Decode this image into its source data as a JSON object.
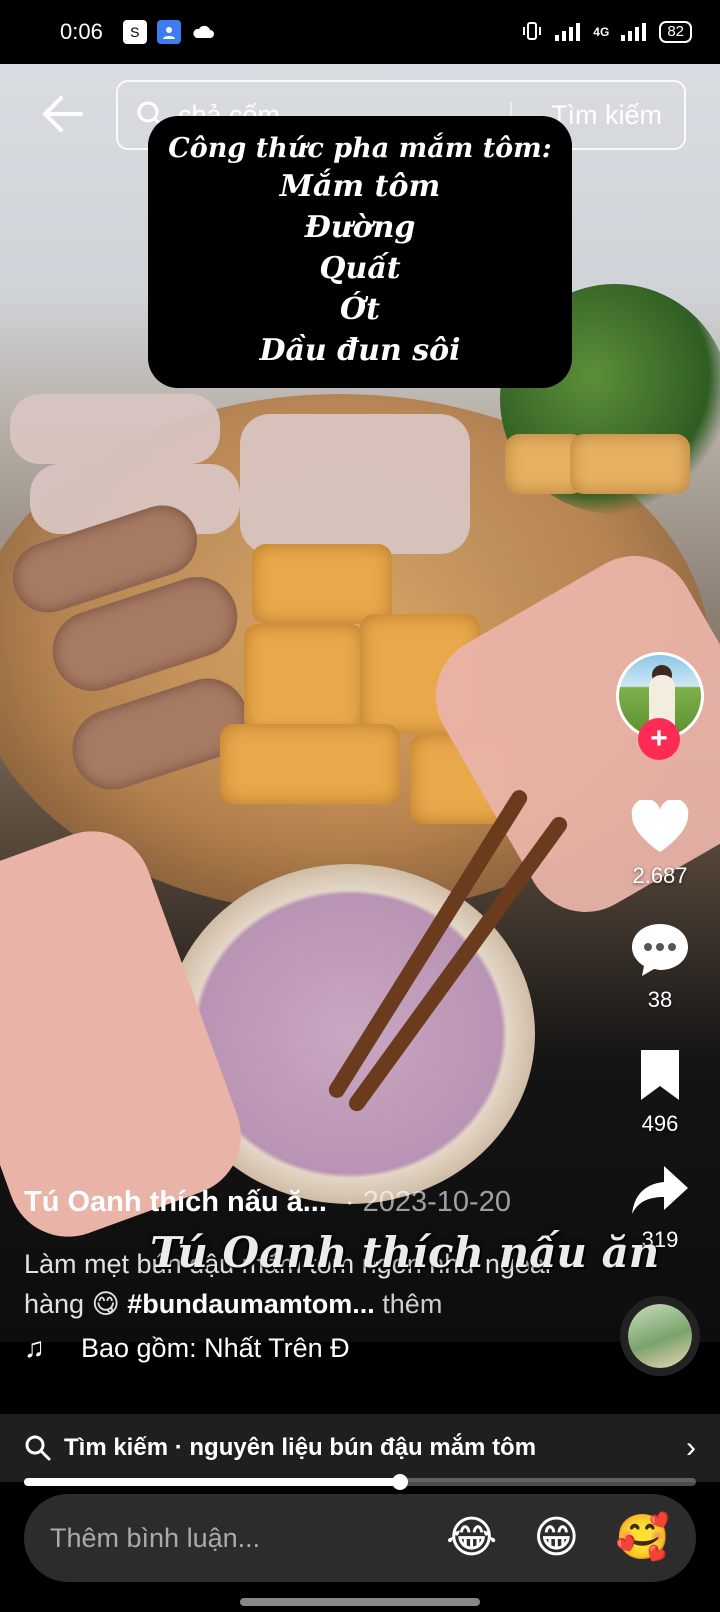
{
  "status_bar": {
    "time": "0:06",
    "network": "4G",
    "battery": "82"
  },
  "search": {
    "query": "chả cốm",
    "submit_label": "Tìm kiếm"
  },
  "recipe_overlay": {
    "title": "Công thức pha mắm tôm:",
    "ingredients": [
      "Mắm tôm",
      "Đường",
      "Quất",
      "Ớt",
      "Dầu đun sôi"
    ]
  },
  "actions": {
    "likes": "2.687",
    "comments": "38",
    "saves": "496",
    "shares": "319",
    "follow_label": "+"
  },
  "video_watermark": "Tú Oanh thích nấu ăn",
  "post": {
    "author": "Tú Oanh thích nấu ă...",
    "date": "· 2023-10-20",
    "description": "Làm mẹt bún đậu mắm tôm ngon như ngoài hàng 😋",
    "hashtag": "#bundaumamtom...",
    "more_label": "thêm",
    "music": "Bao gồm: Nhất Trên Đ"
  },
  "suggestion": {
    "text": "Tìm kiếm · nguyên liệu bún đậu mắm tôm"
  },
  "playback": {
    "progress": 0.56
  },
  "comment": {
    "placeholder": "Thêm bình luận...",
    "emojis": [
      "😂",
      "😁",
      "🥰"
    ]
  },
  "colors": {
    "accent": "#fe2c55",
    "background": "#000000",
    "suggestion_bar": "#1f1f1f",
    "comment_bar": "#2c2c2c"
  }
}
